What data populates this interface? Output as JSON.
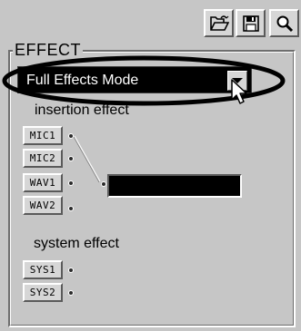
{
  "toolbar": {
    "open_icon": "folder-open-icon",
    "save_icon": "floppy-disk-icon",
    "search_icon": "magnifier-icon"
  },
  "effect_group": {
    "legend": "EFFECT"
  },
  "mode_dropdown": {
    "selected": "Full Effects Mode"
  },
  "insertion_effect": {
    "label": "insertion effect",
    "ports": [
      {
        "label": "MIC1"
      },
      {
        "label": "MIC2"
      },
      {
        "label": "WAV1"
      },
      {
        "label": "WAV2"
      }
    ]
  },
  "system_effect": {
    "label": "system effect",
    "ports": [
      {
        "label": "SYS1"
      },
      {
        "label": "SYS2"
      }
    ]
  },
  "colors": {
    "panel": "#c6c6c6",
    "dropdown_bg": "#000000",
    "dropdown_text": "#ffffff"
  }
}
